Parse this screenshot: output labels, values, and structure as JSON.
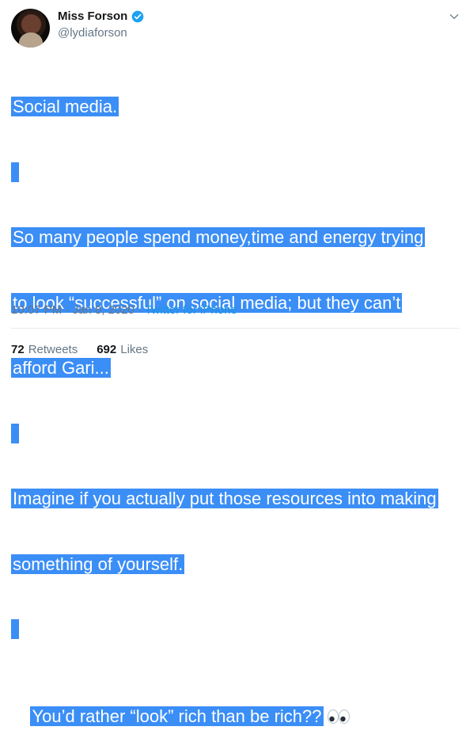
{
  "author": {
    "display_name": "Miss Forson",
    "handle": "@lydiaforson",
    "verified": true,
    "verified_color": "#1da1f2"
  },
  "menu_icon": "chevron-down-icon",
  "tweet": {
    "lines": [
      "Social media.",
      "",
      "So many people spend money,time and energy trying",
      "to look “successful” on social media; but they can’t",
      "afford Gari...",
      "",
      "Imagine if you actually put those resources into making",
      "something of yourself.",
      "",
      "You’d rather “look” rich than be rich??"
    ],
    "emoji": "eyes-emoji",
    "highlight_color": "#3b8ef6"
  },
  "meta": {
    "time": "10:07 PM",
    "separator": " · ",
    "date": "Jan 8, 2020",
    "source": "Twitter for iPhone"
  },
  "stats": {
    "retweets_count": "72",
    "retweets_label": "Retweets",
    "likes_count": "692",
    "likes_label": "Likes"
  }
}
